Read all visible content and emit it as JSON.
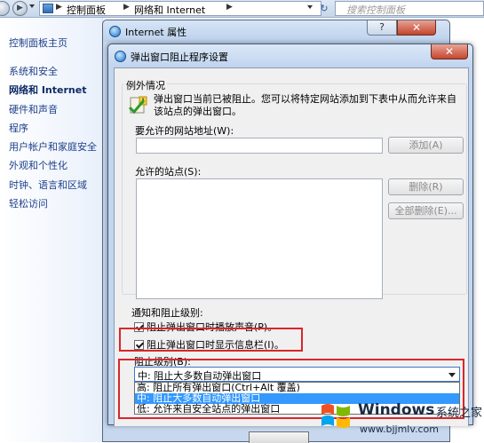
{
  "explorer": {
    "breadcrumb": [
      "控制面板",
      "网络和 Internet"
    ],
    "search_placeholder": "搜索控制面板",
    "refresh_glyph": "↻",
    "forward_glyph": "▶"
  },
  "leftnav": {
    "home": "控制面板主页",
    "items": [
      "系统和安全",
      "网络和 Internet",
      "硬件和声音",
      "程序",
      "用户帐户和家庭安全",
      "外观和个性化",
      "时钟、语言和区域",
      "轻松访问"
    ],
    "active": "网络和 Internet"
  },
  "internet_options": {
    "title": "Internet 属性",
    "help_glyph": "?",
    "close_glyph": "✕"
  },
  "popup_dialog": {
    "title": "弹出窗口阻止程序设置",
    "close_glyph": "✕",
    "exceptions": {
      "legend": "例外情况",
      "description": "弹出窗口当前已被阻止。您可以将特定网站添加到下表中从而允许来自该站点的弹出窗口。",
      "url_label": "要允许的网站地址(W):",
      "url_value": "",
      "add_button": "添加(A)",
      "allowed_label": "允许的站点(S):",
      "allowed_sites": [],
      "remove_button": "删除(R)",
      "remove_all_button": "全部删除(E)..."
    },
    "notifications": {
      "label": "通知和阻止级别:",
      "play_sound": {
        "label": "阻止弹出窗口时播放声音(P)。",
        "checked": true
      },
      "show_info_bar": {
        "label": "阻止弹出窗口时显示信息栏(I)。",
        "checked": true
      },
      "level_label": "阻止级别(B):",
      "level_selected": "中: 阻止大多数自动弹出窗口",
      "level_options": [
        "高: 阻止所有弹出窗口(Ctrl+Alt 覆盖)",
        "中: 阻止大多数自动弹出窗口",
        "低: 允许来自安全站点的弹出窗口"
      ]
    }
  },
  "highlight_color": "#d8262b",
  "selection_color": "#3399ff",
  "watermark": {
    "brand": "Windows",
    "site": "系统之家",
    "url": "www.bjjmlv.com"
  }
}
